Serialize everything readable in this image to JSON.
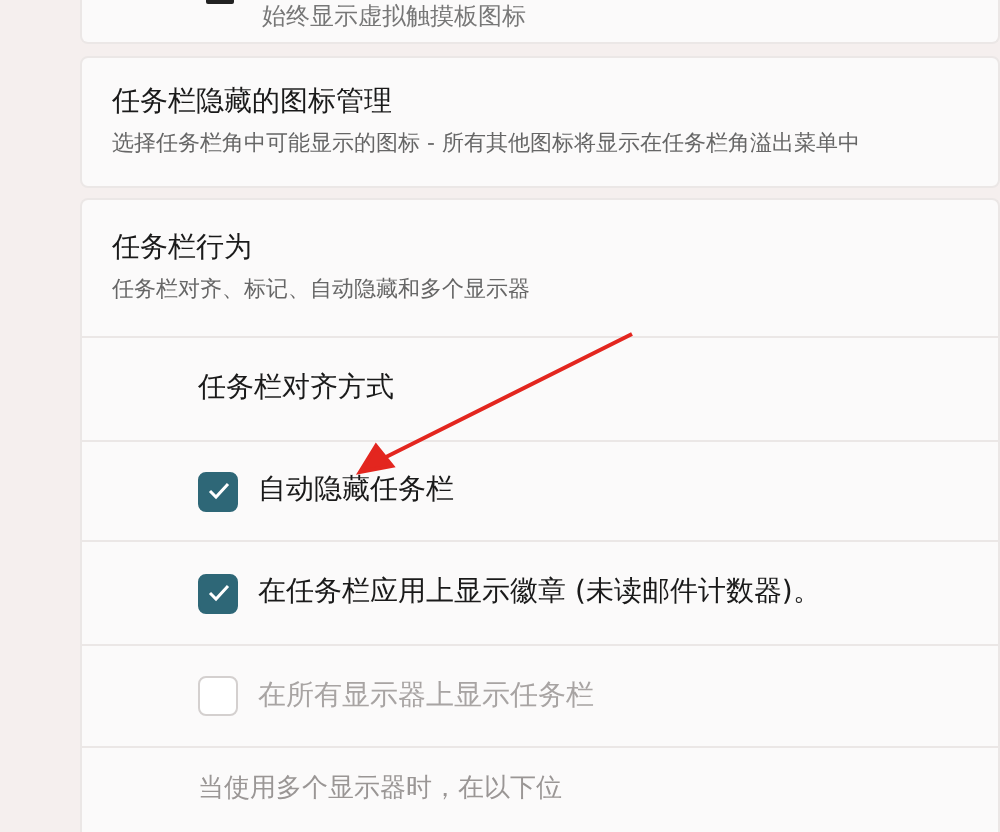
{
  "top_card": {
    "subtitle": "始终显示虚拟触摸板图标"
  },
  "hidden_icons_card": {
    "title": "任务栏隐藏的图标管理",
    "subtitle": "选择任务栏角中可能显示的图标 - 所有其他图标将显示在任务栏角溢出菜单中"
  },
  "behaviors": {
    "title": "任务栏行为",
    "subtitle": "任务栏对齐、标记、自动隐藏和多个显示器",
    "expanded": true,
    "rows": [
      {
        "kind": "label",
        "label": "任务栏对齐方式"
      },
      {
        "kind": "checkbox",
        "label": "自动隐藏任务栏",
        "checked": true,
        "disabled": false
      },
      {
        "kind": "checkbox",
        "label": "在任务栏应用上显示徽章 (未读邮件计数器)。",
        "checked": true,
        "disabled": false
      },
      {
        "kind": "checkbox",
        "label": "在所有显示器上显示任务栏",
        "checked": false,
        "disabled": true
      },
      {
        "kind": "text",
        "label": "当使用多个显示器时，在以下位"
      }
    ]
  }
}
